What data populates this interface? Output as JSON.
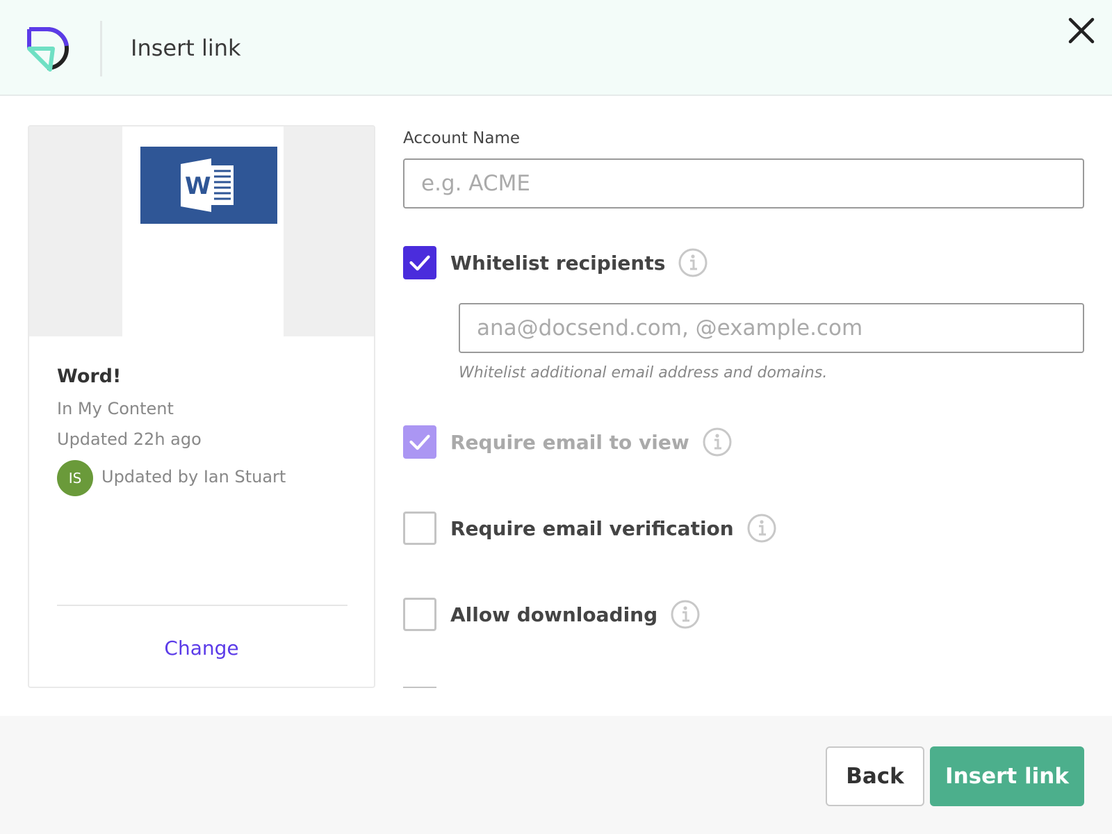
{
  "header": {
    "title": "Insert link",
    "brand_colors": {
      "purple": "#5b3be8",
      "mint": "#6fe0c4",
      "dark": "#222222"
    }
  },
  "file_card": {
    "file_type_icon": "word-document-icon",
    "name": "Word!",
    "location": "In My Content",
    "updated": "Updated 22h ago",
    "avatar_initials": "IS",
    "avatar_color": "#6a9a3a",
    "updated_by": "Updated by Ian Stuart",
    "change_label": "Change"
  },
  "form": {
    "account_name": {
      "label": "Account Name",
      "value": "",
      "placeholder": "e.g. ACME"
    },
    "options": [
      {
        "label": "Whitelist recipients",
        "checked": true,
        "disabled": false
      },
      {
        "label": "Require email to view",
        "checked": true,
        "disabled": true
      },
      {
        "label": "Require email verification",
        "checked": false,
        "disabled": false
      },
      {
        "label": "Allow downloading",
        "checked": false,
        "disabled": false
      }
    ],
    "whitelist": {
      "value": "",
      "placeholder": "ana@docsend.com, @example.com",
      "hint": "Whitelist additional email address and domains."
    }
  },
  "footer": {
    "back_label": "Back",
    "insert_label": "Insert link",
    "primary_color": "#4caf8c"
  }
}
